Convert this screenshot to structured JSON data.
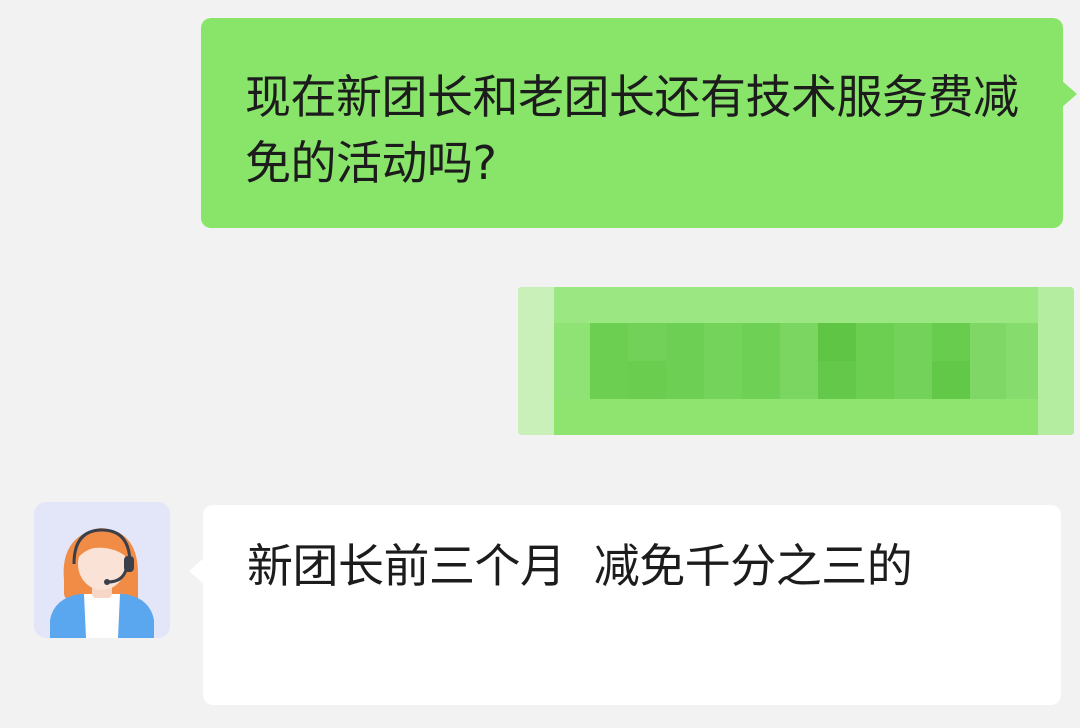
{
  "chat": {
    "messages": [
      {
        "direction": "outgoing",
        "text": "现在新团长和老团长还有技术服务费减免的活动吗?"
      },
      {
        "direction": "outgoing",
        "text": "",
        "redacted": true
      },
      {
        "direction": "incoming",
        "sender_avatar_icon": "customer-service-agent-icon",
        "text": "新团长前三个月  减免千分之三的"
      }
    ]
  },
  "colors": {
    "background": "#f2f2f2",
    "outgoing_bubble": "#89e56a",
    "incoming_bubble": "#ffffff",
    "avatar_background": "#e3e6f8"
  }
}
